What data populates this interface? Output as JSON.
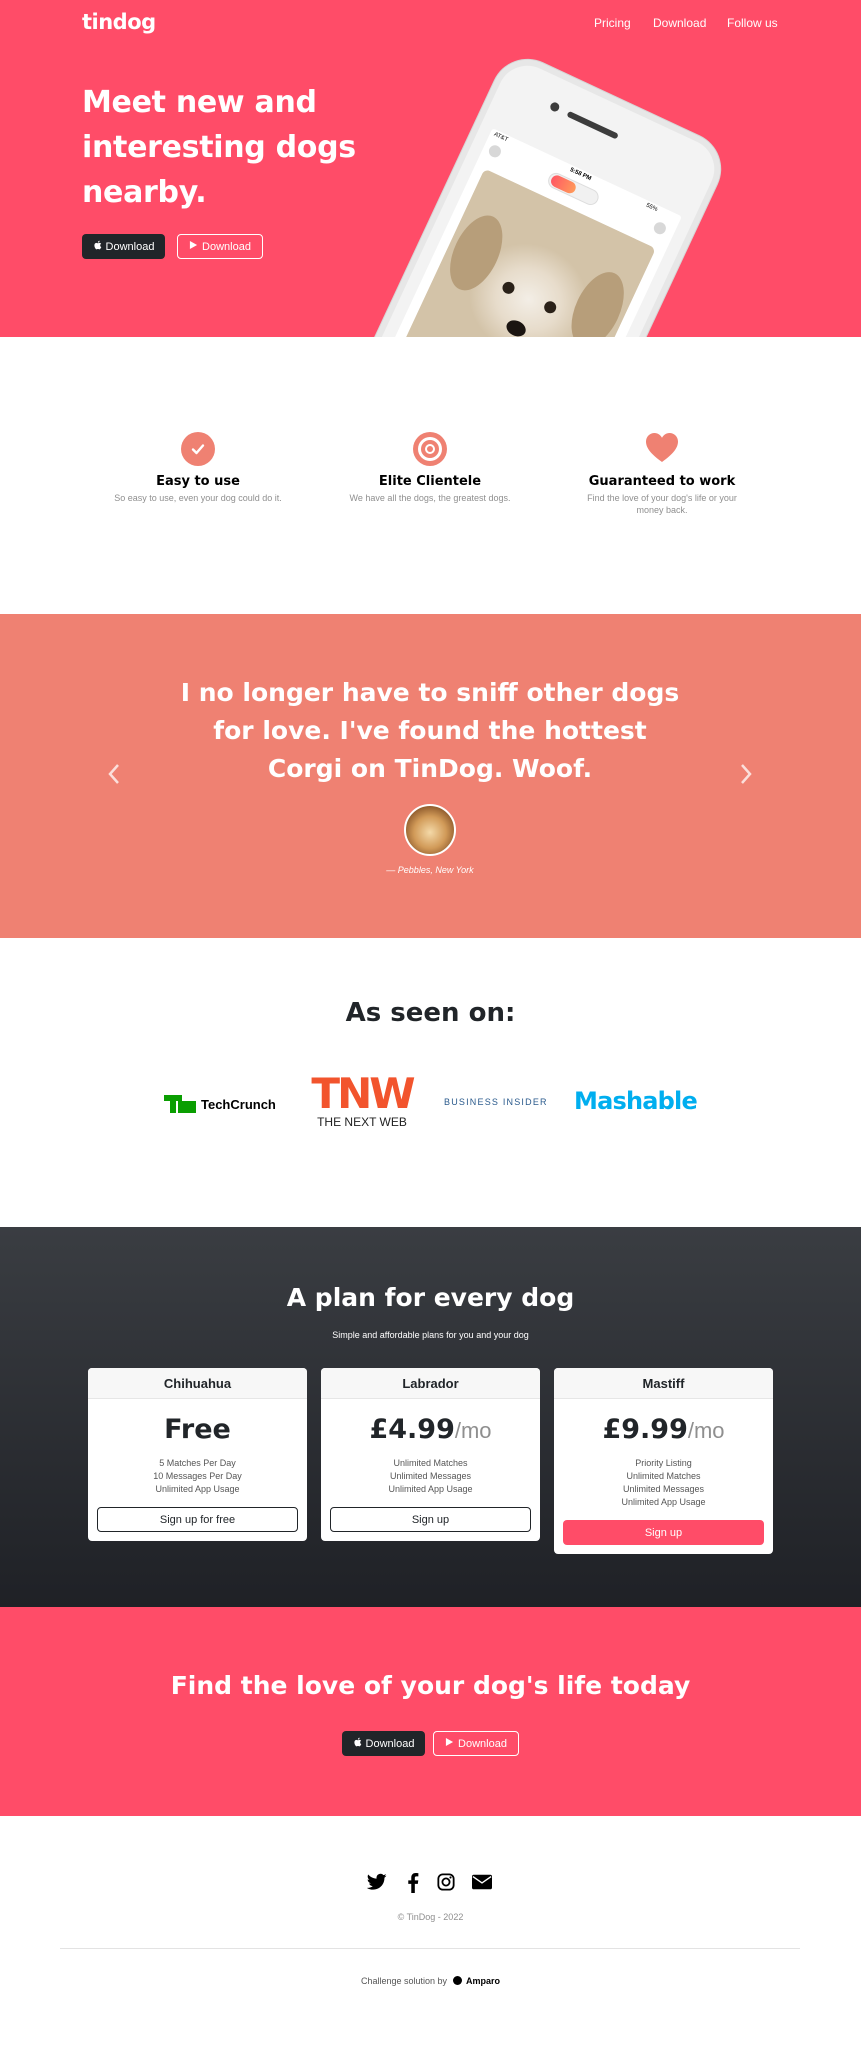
{
  "nav": {
    "brand": "tindog",
    "links": [
      "Pricing",
      "Download",
      "Follow us"
    ]
  },
  "hero": {
    "title": "Meet new and interesting dogs nearby.",
    "download_apple": "Download",
    "download_play": "Download",
    "phone_status": {
      "carrier": "AT&T",
      "time": "5:58 PM",
      "battery": "55%"
    }
  },
  "features": [
    {
      "icon": "check-circle-icon",
      "title": "Easy to use",
      "text": "So easy to use, even your dog could do it."
    },
    {
      "icon": "bullseye-icon",
      "title": "Elite Clientele",
      "text": "We have all the dogs, the greatest dogs."
    },
    {
      "icon": "heart-icon",
      "title": "Guaranteed to work",
      "text": "Find the love of your dog's life or your money back."
    }
  ],
  "testimonial": {
    "quote": "I no longer have to sniff other dogs for love. I've found the hottest Corgi on TinDog. Woof.",
    "author": "— Pebbles, New York"
  },
  "press": {
    "title": "As seen on:",
    "logos": [
      "TechCrunch",
      "TNW",
      "THE NEXT WEB",
      "BUSINESS INSIDER",
      "Mashable"
    ]
  },
  "pricing": {
    "title": "A plan for every dog",
    "subtitle": "Simple and affordable plans for you and your dog",
    "plans": [
      {
        "name": "Chihuahua",
        "price": "Free",
        "period": "",
        "features": [
          "5 Matches Per Day",
          "10 Messages Per Day",
          "Unlimited App Usage"
        ],
        "cta": "Sign up for free"
      },
      {
        "name": "Labrador",
        "price": "£4.99",
        "period": "/mo",
        "features": [
          "Unlimited Matches",
          "Unlimited Messages",
          "Unlimited App Usage"
        ],
        "cta": "Sign up"
      },
      {
        "name": "Mastiff",
        "price": "£9.99",
        "period": "/mo",
        "features": [
          "Priority Listing",
          "Unlimited Matches",
          "Unlimited Messages",
          "Unlimited App Usage"
        ],
        "cta": "Sign up"
      }
    ]
  },
  "cta": {
    "title": "Find the love of your dog's life today",
    "download_apple": "Download",
    "download_play": "Download"
  },
  "footer": {
    "social": [
      "twitter-icon",
      "facebook-icon",
      "instagram-icon",
      "envelope-icon"
    ],
    "copyright": "© TinDog - 2022",
    "credit_prefix": "Challenge solution by",
    "credit_name": "Amparo"
  },
  "colors": {
    "primary": "#ff4c68",
    "coral": "#ef8172",
    "dark": "#212529"
  }
}
